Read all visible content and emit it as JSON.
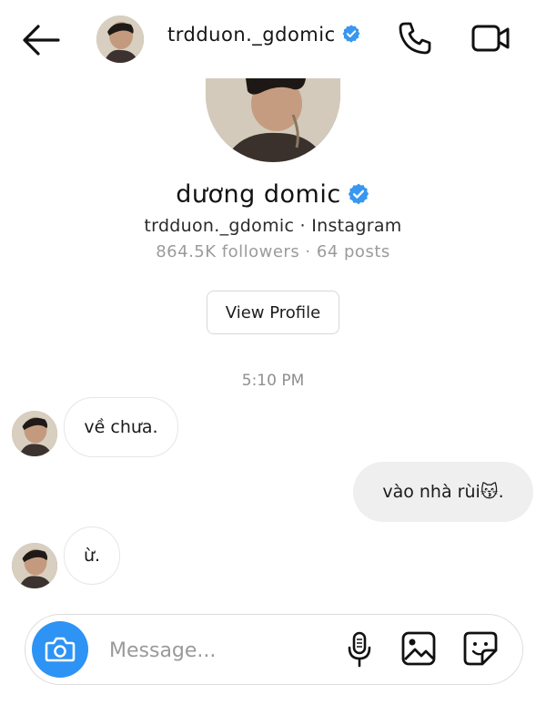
{
  "header": {
    "username": "trdduon._gdomic",
    "verified": true
  },
  "profile": {
    "display_name": "dương domic",
    "handle_line": "trdduon._gdomic · Instagram",
    "stats_line": "864.5K followers · 64 posts",
    "view_profile_label": "View Profile"
  },
  "conversation": {
    "timestamp": "5:10 PM",
    "messages": [
      {
        "direction": "incoming",
        "text": "về chưa."
      },
      {
        "direction": "outgoing",
        "text": "vào nhà rùi😽."
      },
      {
        "direction": "incoming",
        "text": "ừ."
      }
    ]
  },
  "composer": {
    "placeholder": "Message..."
  },
  "colors": {
    "accent_blue": "#2d93f4",
    "verified_blue": "#3897f0",
    "outgoing_bubble": "#efefef",
    "muted_text": "#9b9b9b"
  },
  "icons": {
    "back": "arrow-left-icon",
    "call": "phone-icon",
    "video": "video-camera-icon",
    "camera": "camera-icon",
    "mic": "microphone-icon",
    "gallery": "image-icon",
    "sticker": "sticker-icon",
    "verified": "verified-badge-icon"
  }
}
